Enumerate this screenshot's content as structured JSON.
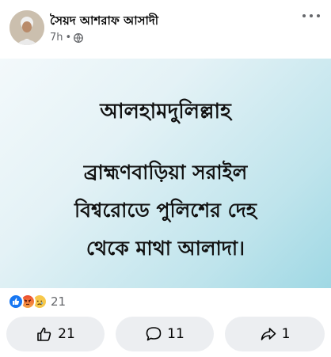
{
  "post": {
    "author": "সৈয়দ আশরাফ আসাদী",
    "time": "7h",
    "separator": "•",
    "privacy_icon": "globe-icon",
    "menu_icon": "more-options-icon"
  },
  "image_text": {
    "line1": "আলহামদুলিল্লাহ",
    "line2": "ব্রাহ্মণবাড়িয়া সরাইল",
    "line3": "বিশ্বরোডে পুলিশের দেহ",
    "line4": "থেকে মাথা আলাদা।"
  },
  "reactions": {
    "types": [
      "like",
      "angry",
      "sad"
    ],
    "count": "21"
  },
  "actions": {
    "like_count": "21",
    "comment_count": "11",
    "share_count": "1"
  },
  "colors": {
    "like_blue": "#1877f2",
    "button_bg": "#eceef1",
    "meta_gray": "#65676b",
    "image_gradient_end": "#9fd8e4"
  }
}
